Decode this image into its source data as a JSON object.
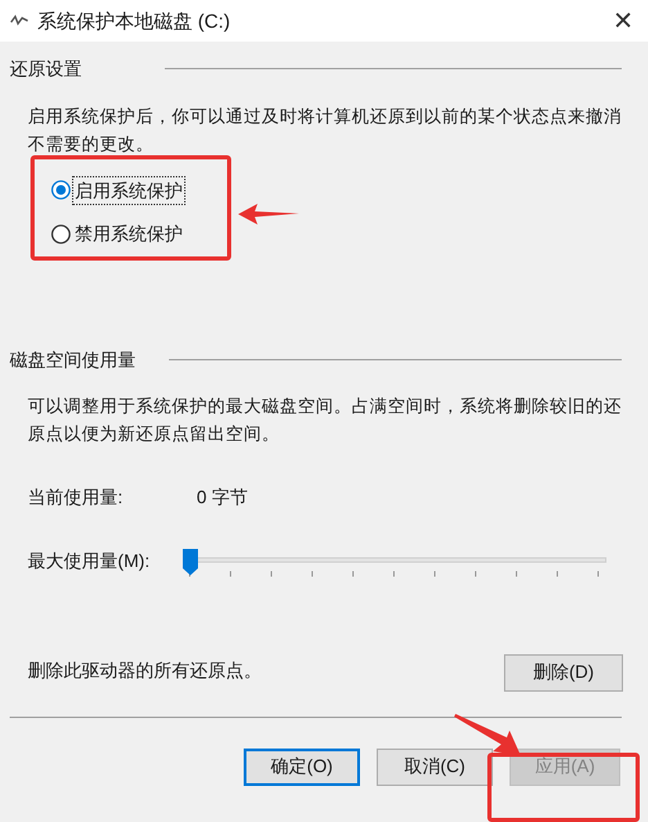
{
  "window": {
    "title": "系统保护本地磁盘 (C:)",
    "close": "✕"
  },
  "restore_settings": {
    "heading": "还原设置",
    "description": "启用系统保护后，你可以通过及时将计算机还原到以前的某个状态点来撤消不需要的更改。",
    "options": [
      {
        "label": "启用系统保护",
        "selected": true
      },
      {
        "label": "禁用系统保护",
        "selected": false
      }
    ]
  },
  "disk_usage": {
    "heading": "磁盘空间使用量",
    "description": "可以调整用于系统保护的最大磁盘空间。占满空间时，系统将删除较旧的还原点以便为新还原点留出空间。",
    "current_label": "当前使用量:",
    "current_value": "0 字节",
    "max_label": "最大使用量(M):",
    "slider": {
      "level": 0
    }
  },
  "delete": {
    "text": "删除此驱动器的所有还原点。",
    "button": "删除(D)"
  },
  "buttons": [
    {
      "label": "确定(O)",
      "default": true,
      "disabled": false
    },
    {
      "label": "取消(C)",
      "default": false,
      "disabled": false
    },
    {
      "label": "应用(A)",
      "default": false,
      "disabled": true
    }
  ]
}
